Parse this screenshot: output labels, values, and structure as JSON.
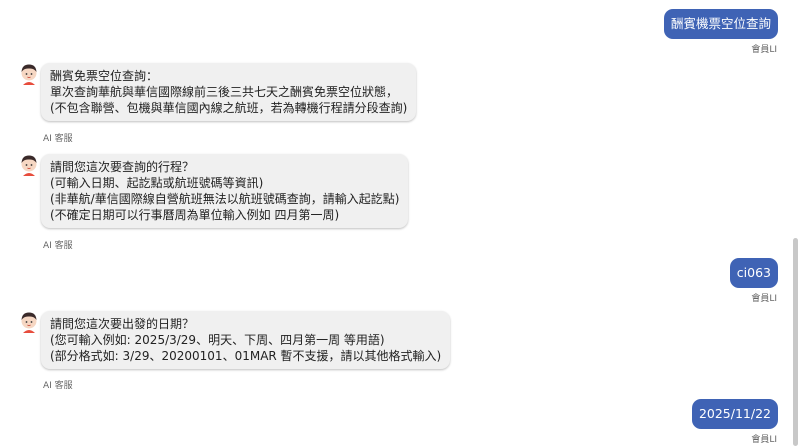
{
  "messages": [
    {
      "role": "user",
      "text": "酬賓機票空位查詢",
      "sender": "會員LI"
    },
    {
      "role": "bot",
      "lines": [
        "酬賓免票空位查詢：",
        "單次查詢華航與華信國際線前三後三共七天之酬賓免票空位狀態，",
        "(不包含聯營、包機與華信國內線之航班，若為轉機行程請分段查詢)"
      ],
      "sender": "AI 客服"
    },
    {
      "role": "bot",
      "lines": [
        "請問您這次要查詢的行程？",
        "(可輸入日期、起訖點或航班號碼等資訊)",
        "(非華航/華信國際線自營航班無法以航班號碼查詢，請輸入起訖點)",
        "(不確定日期可以行事曆周為單位輸入例如 四月第一周)"
      ],
      "sender": "AI 客服"
    },
    {
      "role": "user",
      "text": "ci063",
      "sender": "會員LI"
    },
    {
      "role": "bot",
      "lines": [
        "請問您這次要出發的日期？",
        "(您可輸入例如: 2025/3/29、明天、下周、四月第一周 等用語)",
        "(部分格式如: 3/29、20200101、01MAR 暫不支援，請以其他格式輸入)"
      ],
      "sender": "AI 客服"
    },
    {
      "role": "user",
      "text": "2025/11/22",
      "sender": "會員LI"
    }
  ],
  "colors": {
    "user_bubble": "#3f63b5",
    "bot_bubble": "#f0f0f0"
  },
  "icons": {
    "bot_avatar": "person-avatar-icon"
  }
}
